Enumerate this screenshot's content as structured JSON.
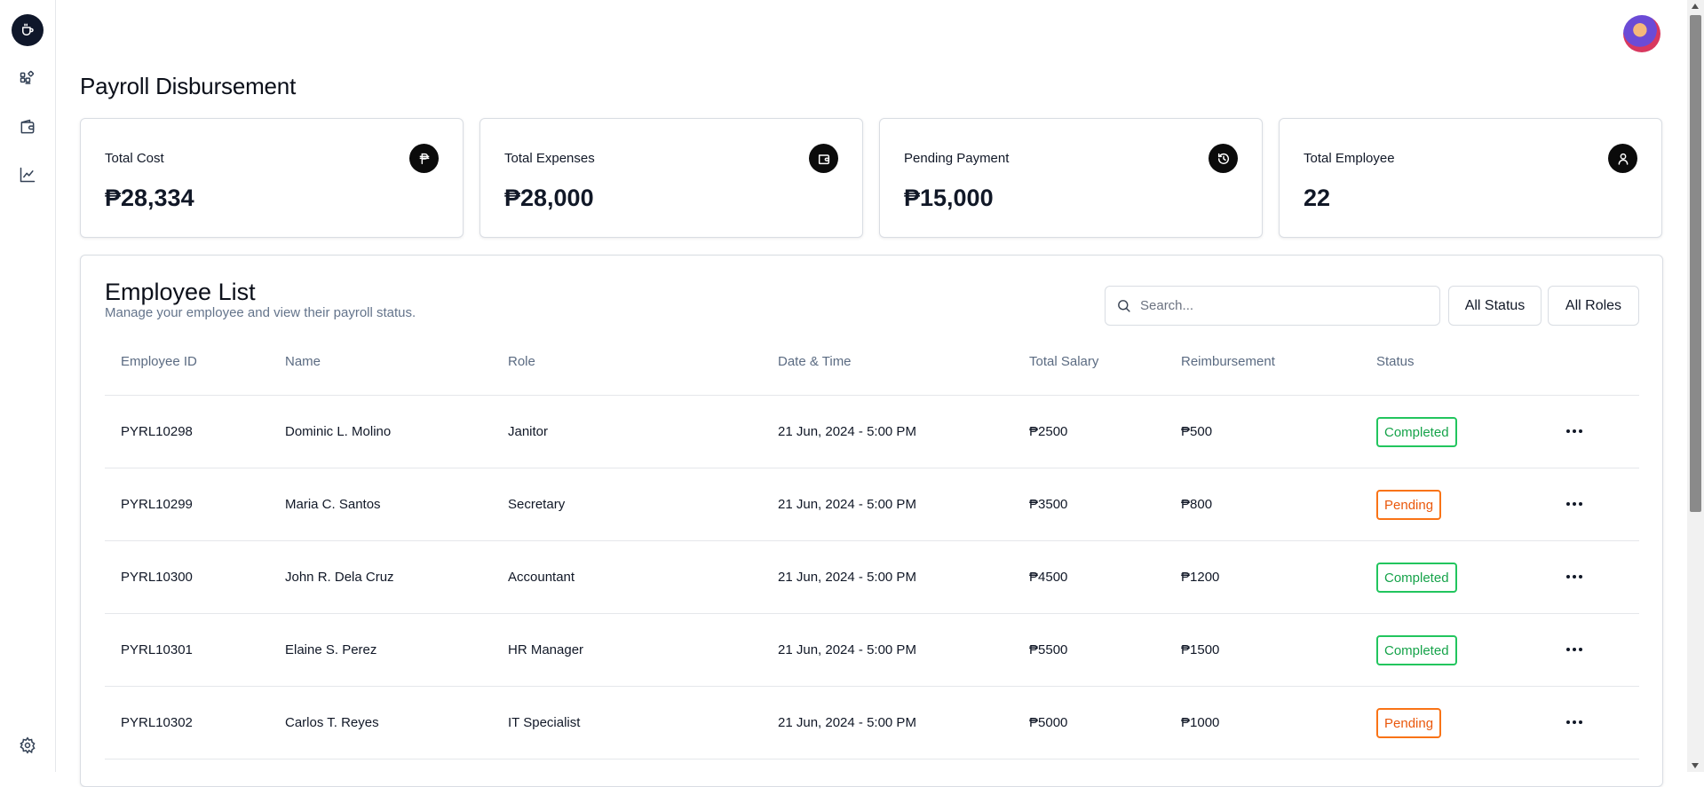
{
  "page": {
    "title": "Payroll Disbursement"
  },
  "sidebar": {
    "items": [
      {
        "icon": "dashboard-icon"
      },
      {
        "icon": "wallet-icon"
      },
      {
        "icon": "chart-line-icon"
      }
    ],
    "settings_icon": "gear-icon"
  },
  "stats": [
    {
      "label": "Total Cost",
      "value": "₱28,334",
      "icon": "peso-icon"
    },
    {
      "label": "Total Expenses",
      "value": "₱28,000",
      "icon": "wallet-icon"
    },
    {
      "label": "Pending Payment",
      "value": "₱15,000",
      "icon": "history-icon"
    },
    {
      "label": "Total Employee",
      "value": "22",
      "icon": "user-icon"
    }
  ],
  "employees": {
    "title": "Employee List",
    "subtitle": "Manage your employee and view their payroll status.",
    "search_placeholder": "Search...",
    "filters": {
      "status": "All Status",
      "roles": "All Roles"
    },
    "columns": [
      "Employee ID",
      "Name",
      "Role",
      "Date & Time",
      "Total Salary",
      "Reimbursement",
      "Status"
    ],
    "rows": [
      {
        "id": "PYRL10298",
        "name": "Dominic L. Molino",
        "role": "Janitor",
        "datetime": "21 Jun, 2024 - 5:00 PM",
        "salary": "₱2500",
        "reimbursement": "₱500",
        "status": "Completed"
      },
      {
        "id": "PYRL10299",
        "name": "Maria C. Santos",
        "role": "Secretary",
        "datetime": "21 Jun, 2024 - 5:00 PM",
        "salary": "₱3500",
        "reimbursement": "₱800",
        "status": "Pending"
      },
      {
        "id": "PYRL10300",
        "name": "John R. Dela Cruz",
        "role": "Accountant",
        "datetime": "21 Jun, 2024 - 5:00 PM",
        "salary": "₱4500",
        "reimbursement": "₱1200",
        "status": "Completed"
      },
      {
        "id": "PYRL10301",
        "name": "Elaine S. Perez",
        "role": "HR Manager",
        "datetime": "21 Jun, 2024 - 5:00 PM",
        "salary": "₱5500",
        "reimbursement": "₱1500",
        "status": "Completed"
      },
      {
        "id": "PYRL10302",
        "name": "Carlos T. Reyes",
        "role": "IT Specialist",
        "datetime": "21 Jun, 2024 - 5:00 PM",
        "salary": "₱5000",
        "reimbursement": "₱1000",
        "status": "Pending"
      }
    ]
  },
  "colors": {
    "completed": "#22c55e",
    "pending": "#f97316",
    "dark": "#0b0b0b",
    "muted": "#64748b"
  }
}
